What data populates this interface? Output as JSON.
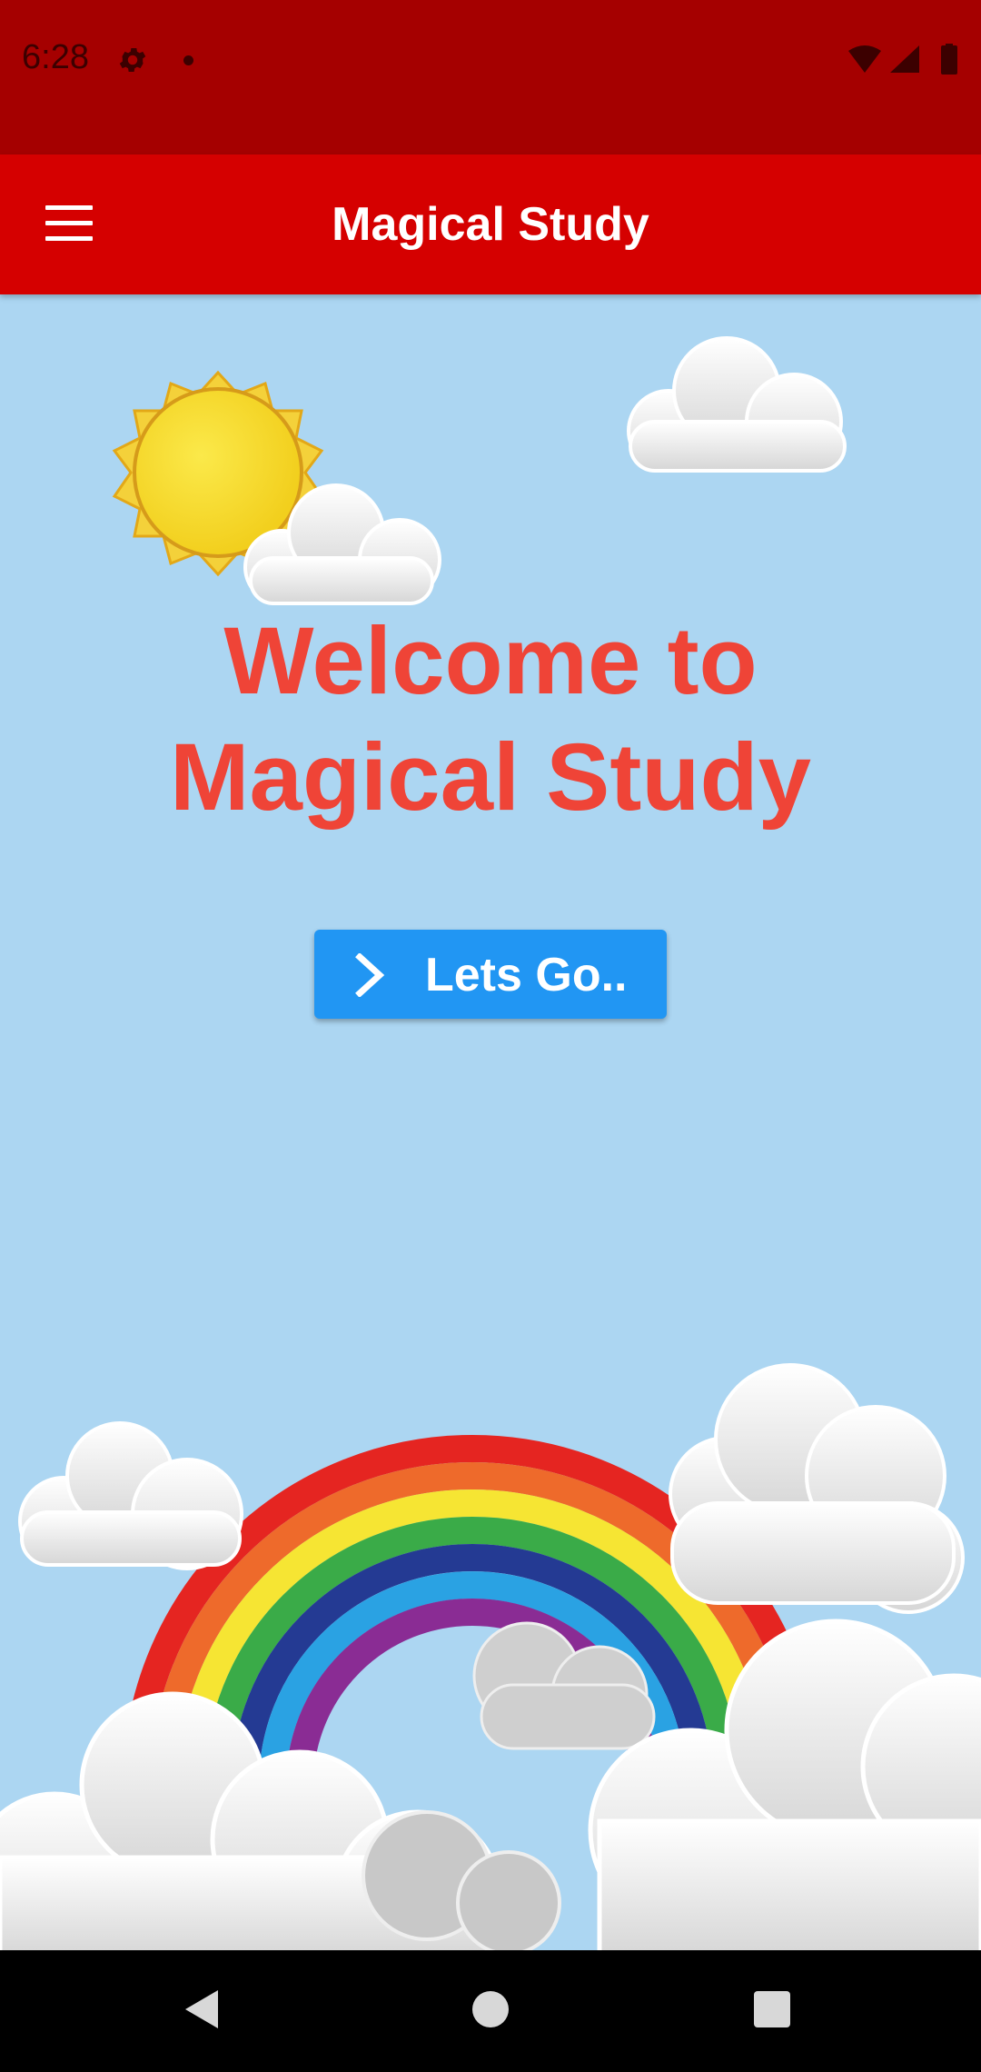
{
  "status_bar": {
    "time": "6:28",
    "icons": [
      "gear-icon",
      "notification-dot-icon",
      "wifi-icon",
      "signal-icon",
      "battery-icon"
    ]
  },
  "app_bar": {
    "title": "Magical Study",
    "menu_icon": "hamburger-menu-icon",
    "background_color": "#d50000"
  },
  "main": {
    "welcome_line1": "Welcome to",
    "welcome_line2": "Magical Study",
    "welcome_color": "#ef4437",
    "button": {
      "label": "Lets Go..",
      "icon": "chevron-right-icon",
      "color": "#2196f3"
    },
    "background_color": "#acd6f2"
  },
  "nav_bar": {
    "buttons": [
      "back-icon",
      "home-icon",
      "recents-icon"
    ]
  }
}
